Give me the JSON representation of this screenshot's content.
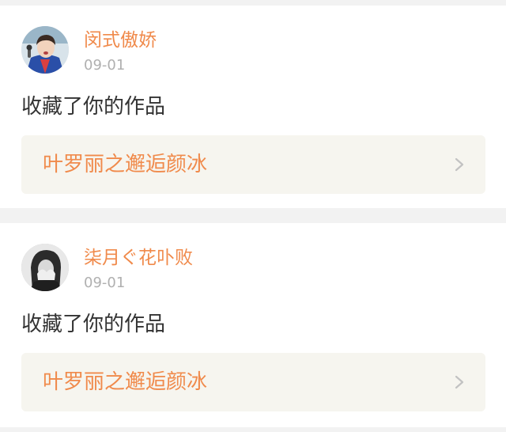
{
  "notifications": [
    {
      "username": "闵式傲娇",
      "timestamp": "09-01",
      "action": "收藏了你的作品",
      "work_title": "叶罗丽之邂逅颜冰",
      "avatar_icon": "user-avatar-photo"
    },
    {
      "username": "柒月ぐ花卟败",
      "timestamp": "09-01",
      "action": "收藏了你的作品",
      "work_title": "叶罗丽之邂逅颜冰",
      "avatar_icon": "user-avatar-photo"
    }
  ],
  "colors": {
    "accent": "#f08a4b",
    "timestamp": "#b0b0b0",
    "text": "#333333",
    "card_background": "#ffffff",
    "link_background": "#f6f5ef",
    "page_background": "#f2f2f2"
  }
}
